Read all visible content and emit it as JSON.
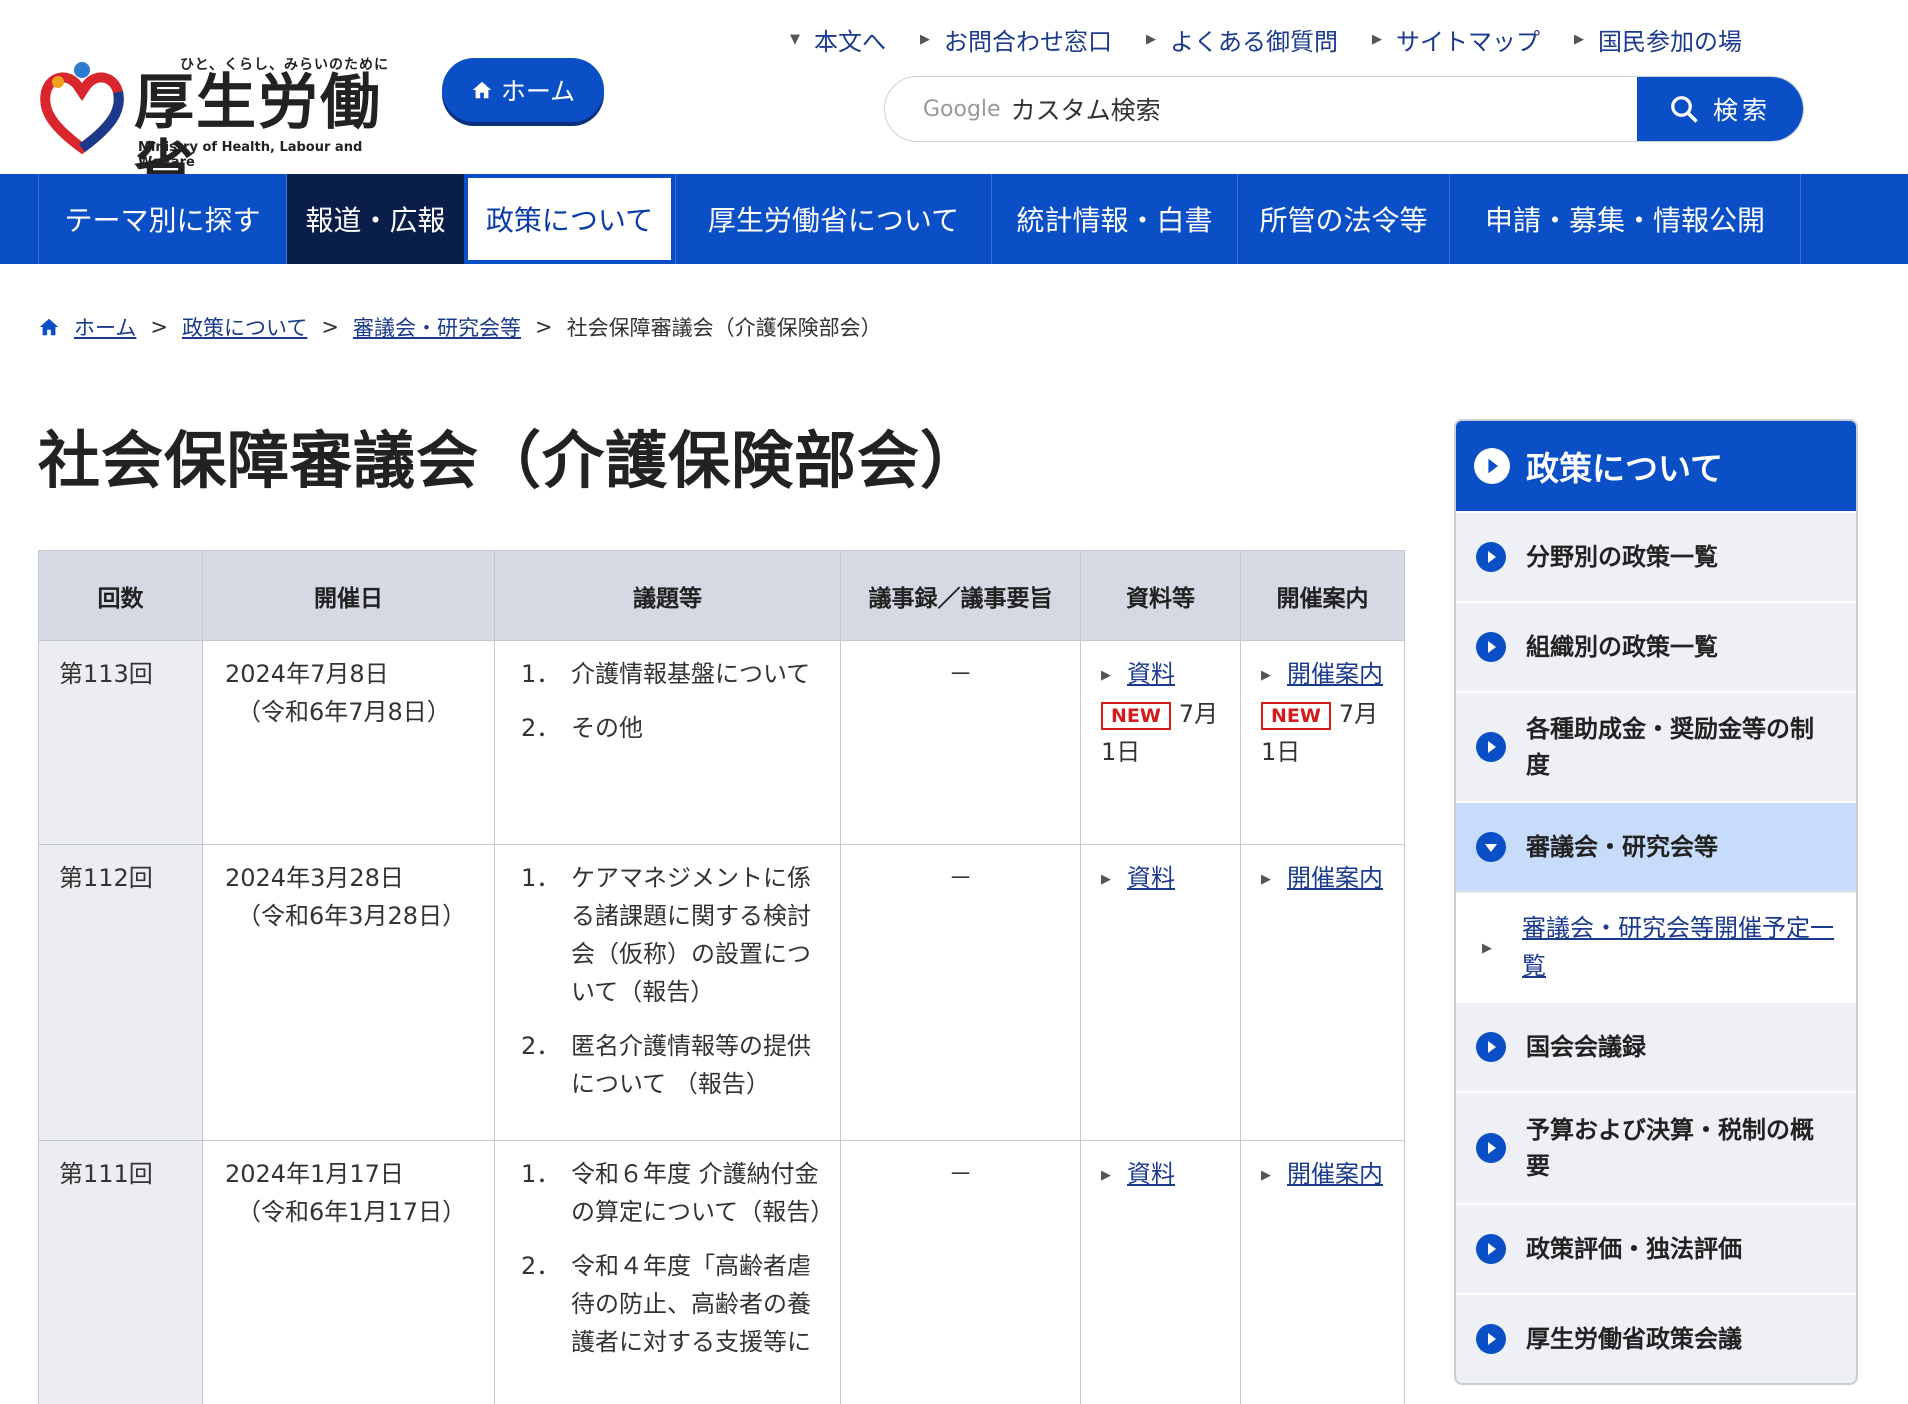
{
  "header": {
    "logo_tagline": "ひと、くらし、みらいのために",
    "logo_name": "厚生労働省",
    "logo_en": "Ministry of Health, Labour and Welfare",
    "home_button": "ホーム",
    "util_links": [
      "本文へ",
      "お問合わせ窓口",
      "よくある御質問",
      "サイトマップ",
      "国民参加の場"
    ],
    "search_google": "Google",
    "search_placeholder": "カスタム検索",
    "search_button": "検索"
  },
  "nav": {
    "items": [
      "テーマ別に探す",
      "報道・広報",
      "政策について",
      "厚生労働省について",
      "統計情報・白書",
      "所管の法令等",
      "申請・募集・情報公開"
    ]
  },
  "breadcrumb": {
    "items": [
      "ホーム",
      "政策について",
      "審議会・研究会等"
    ],
    "current": "社会保障審議会（介護保険部会）",
    "sep": ">"
  },
  "page": {
    "title": "社会保障審議会（介護保険部会）"
  },
  "table": {
    "headers": [
      "回数",
      "開催日",
      "議題等",
      "議事録／議事要旨",
      "資料等",
      "開催案内"
    ],
    "rows": [
      {
        "no": "第113回",
        "date": "2024年7月8日",
        "date_wareki": "（令和6年7月8日）",
        "topics": [
          {
            "num": "1．",
            "text": "介護情報基盤について"
          },
          {
            "num": "2．",
            "text": "その他"
          }
        ],
        "minutes": "－",
        "doc_link": "資料",
        "doc_badge": "NEW",
        "doc_date": "7月1日",
        "info_link": "開催案内",
        "info_badge": "NEW",
        "info_date": "7月1日"
      },
      {
        "no": "第112回",
        "date": "2024年3月28日",
        "date_wareki": "（令和6年3月28日）",
        "topics": [
          {
            "num": "1．",
            "text": "ケアマネジメントに係る諸課題に関する検討会（仮称）の設置について（報告）"
          },
          {
            "num": "2．",
            "text": "匿名介護情報等の提供について （報告）"
          }
        ],
        "minutes": "－",
        "doc_link": "資料",
        "info_link": "開催案内"
      },
      {
        "no": "第111回",
        "date": "2024年1月17日",
        "date_wareki": "（令和6年1月17日）",
        "topics": [
          {
            "num": "1．",
            "text": "令和６年度 介護納付金の算定について（報告）"
          },
          {
            "num": "2．",
            "text": "令和４年度「高齢者虐待の防止、高齢者の養護者に対する支援等に"
          }
        ],
        "minutes": "－",
        "doc_link": "資料",
        "info_link": "開催案内"
      }
    ]
  },
  "sidebar": {
    "title": "政策について",
    "items": [
      "分野別の政策一覧",
      "組織別の政策一覧",
      "各種助成金・奨励金等の制度",
      "審議会・研究会等",
      "国会会議録",
      "予算および決算・税制の概要",
      "政策評価・独法評価",
      "厚生労働省政策会議"
    ],
    "sub_item": "審議会・研究会等開催予定一覧"
  },
  "colors": {
    "brand_blue": "#0a4fc6",
    "nav_dark": "#0a1e4a",
    "badge_red": "#d41a1a"
  }
}
